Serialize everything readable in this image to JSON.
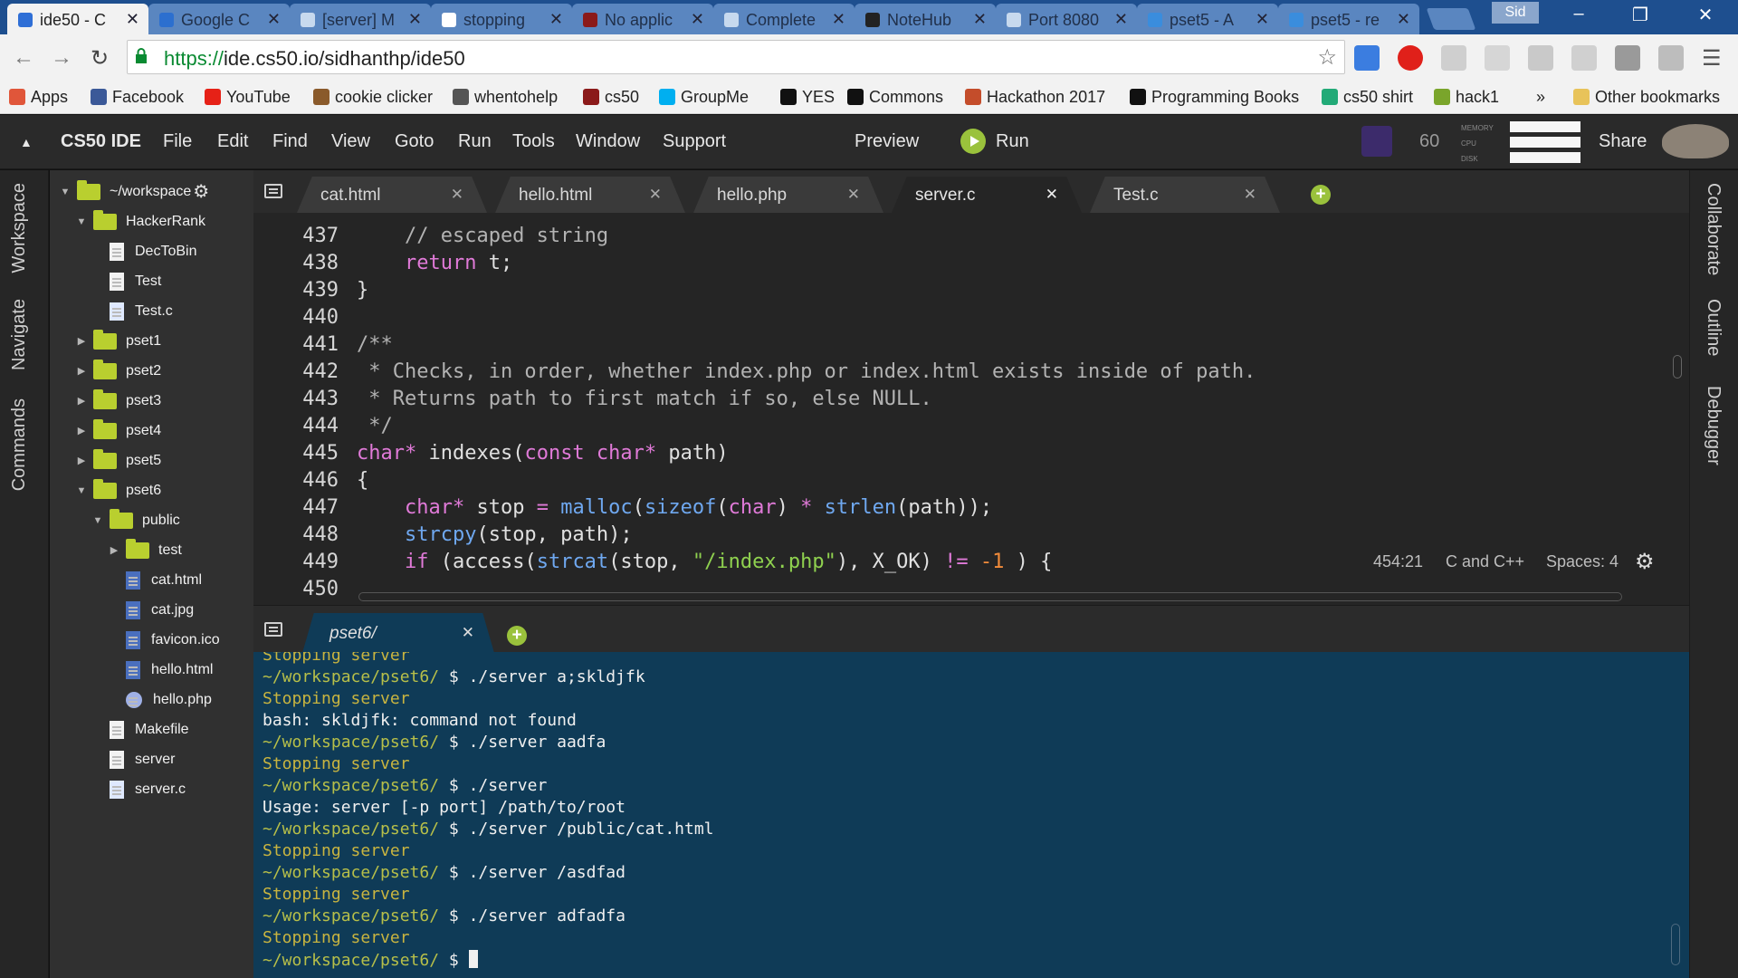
{
  "browser": {
    "tabs": [
      {
        "title": "ide50 - C",
        "color": "#2f6fd6",
        "active": true
      },
      {
        "title": "Google C",
        "color": "#2c6fcf"
      },
      {
        "title": "[server] M",
        "color": "#c7d9ee"
      },
      {
        "title": "stopping",
        "color": "#ffffff"
      },
      {
        "title": "No applic",
        "color": "#8b1a1a"
      },
      {
        "title": "Complete",
        "color": "#c7d9ee"
      },
      {
        "title": "NoteHub",
        "color": "#222222"
      },
      {
        "title": "Port 8080",
        "color": "#c7d9ee"
      },
      {
        "title": "pset5 - A",
        "color": "#3a8ddd"
      },
      {
        "title": "pset5 - re",
        "color": "#3a8ddd"
      }
    ],
    "tab_close": "✕",
    "user_chip": "Sid",
    "window_controls": {
      "minimize": "–",
      "maximize": "❐",
      "close": "✕"
    },
    "url_scheme": "https://",
    "url_rest": "ide.cs50.io/sidhanthp/ide50",
    "bookmarks": [
      {
        "label": "Apps",
        "icon": "apps-grid-icon",
        "color": "#e0563a"
      },
      {
        "label": "Facebook",
        "icon": "facebook-icon",
        "color": "#3b5998"
      },
      {
        "label": "YouTube",
        "icon": "youtube-icon",
        "color": "#e62117"
      },
      {
        "label": "cookie clicker",
        "icon": "cookie-icon",
        "color": "#8a5a2b"
      },
      {
        "label": "whentohelp",
        "icon": "w-icon",
        "color": "#555555"
      },
      {
        "label": "cs50",
        "icon": "harvard-shield-icon",
        "color": "#8b1a1a"
      },
      {
        "label": "GroupMe",
        "icon": "groupme-icon",
        "color": "#00aff0"
      },
      {
        "label": "YES",
        "icon": "v-icon",
        "color": "#111111"
      },
      {
        "label": "Commons",
        "icon": "commons-icon",
        "color": "#111111"
      },
      {
        "label": "Hackathon 2017",
        "icon": "hackathon-icon",
        "color": "#c44d2b"
      },
      {
        "label": "Programming Books",
        "icon": "github-icon",
        "color": "#111111"
      },
      {
        "label": "cs50 shirt",
        "icon": "shirt-icon",
        "color": "#22aa77"
      },
      {
        "label": "hack1",
        "icon": "h-icon",
        "color": "#7aa52b"
      }
    ],
    "bookmarks_overflow": "»",
    "other_bookmarks": "Other bookmarks"
  },
  "ide": {
    "brand": "CS50 IDE",
    "menu": [
      "File",
      "Edit",
      "Find",
      "View",
      "Goto",
      "Run",
      "Tools",
      "Window",
      "Support"
    ],
    "preview": "Preview",
    "run": "Run",
    "count": "60",
    "meter_labels": [
      "MEMORY",
      "CPU",
      "DISK"
    ],
    "share": "Share",
    "left_tabs": [
      "Workspace",
      "Navigate",
      "Commands"
    ],
    "right_tabs": [
      "Collaborate",
      "Outline",
      "Debugger"
    ],
    "tree": [
      {
        "label": "~/workspace",
        "type": "folder",
        "depth": 0,
        "open": true
      },
      {
        "label": "HackerRank",
        "type": "folder",
        "depth": 1,
        "open": true
      },
      {
        "label": "DecToBin",
        "type": "file",
        "depth": 2
      },
      {
        "label": "Test",
        "type": "file",
        "depth": 2
      },
      {
        "label": "Test.c",
        "type": "c",
        "depth": 2
      },
      {
        "label": "pset1",
        "type": "folder",
        "depth": 1,
        "open": false
      },
      {
        "label": "pset2",
        "type": "folder",
        "depth": 1,
        "open": false
      },
      {
        "label": "pset3",
        "type": "folder",
        "depth": 1,
        "open": false
      },
      {
        "label": "pset4",
        "type": "folder",
        "depth": 1,
        "open": false
      },
      {
        "label": "pset5",
        "type": "folder",
        "depth": 1,
        "open": false
      },
      {
        "label": "pset6",
        "type": "folder",
        "depth": 1,
        "open": true
      },
      {
        "label": "public",
        "type": "folder",
        "depth": 2,
        "open": true
      },
      {
        "label": "test",
        "type": "folder",
        "depth": 3,
        "open": false
      },
      {
        "label": "cat.html",
        "type": "img",
        "depth": 3
      },
      {
        "label": "cat.jpg",
        "type": "img",
        "depth": 3
      },
      {
        "label": "favicon.ico",
        "type": "img",
        "depth": 3
      },
      {
        "label": "hello.html",
        "type": "img",
        "depth": 3
      },
      {
        "label": "hello.php",
        "type": "php",
        "depth": 3
      },
      {
        "label": "Makefile",
        "type": "file",
        "depth": 2
      },
      {
        "label": "server",
        "type": "file",
        "depth": 2
      },
      {
        "label": "server.c",
        "type": "c",
        "depth": 2
      }
    ],
    "editor_tabs": [
      {
        "label": "cat.html",
        "active": false
      },
      {
        "label": "hello.html",
        "active": false
      },
      {
        "label": "hello.php",
        "active": false
      },
      {
        "label": "server.c",
        "active": true
      },
      {
        "label": "Test.c",
        "active": false
      }
    ],
    "code": [
      {
        "n": "437",
        "parts": [
          [
            "cm",
            "    // escaped string"
          ]
        ]
      },
      {
        "n": "438",
        "parts": [
          [
            "kw",
            "    return"
          ],
          [
            "",
            " t;"
          ]
        ]
      },
      {
        "n": "439",
        "parts": [
          [
            "",
            "}"
          ]
        ]
      },
      {
        "n": "440",
        "parts": []
      },
      {
        "n": "441",
        "parts": [
          [
            "cm",
            "/**"
          ]
        ]
      },
      {
        "n": "442",
        "parts": [
          [
            "cm",
            " * Checks, in order, whether index.php or index.html exists inside of path."
          ]
        ]
      },
      {
        "n": "443",
        "parts": [
          [
            "cm",
            " * Returns path to first match if so, else NULL."
          ]
        ]
      },
      {
        "n": "444",
        "parts": [
          [
            "cm",
            " */"
          ]
        ]
      },
      {
        "n": "445",
        "parts": [
          [
            "kw",
            "char"
          ],
          [
            "op",
            "*"
          ],
          [
            "",
            " indexes("
          ],
          [
            "kw",
            "const char"
          ],
          [
            "op",
            "*"
          ],
          [
            "",
            " path)"
          ]
        ]
      },
      {
        "n": "446",
        "parts": [
          [
            "",
            "{"
          ]
        ]
      },
      {
        "n": "447",
        "parts": [
          [
            "kw",
            "    char"
          ],
          [
            "op",
            "*"
          ],
          [
            "",
            " stop "
          ],
          [
            "op",
            "="
          ],
          [
            "",
            " "
          ],
          [
            "fn",
            "malloc"
          ],
          [
            "",
            "("
          ],
          [
            "fn",
            "sizeof"
          ],
          [
            "",
            "("
          ],
          [
            "kw",
            "char"
          ],
          [
            "",
            ") "
          ],
          [
            "op",
            "*"
          ],
          [
            "",
            " "
          ],
          [
            "fn",
            "strlen"
          ],
          [
            "",
            "(path));"
          ]
        ]
      },
      {
        "n": "448",
        "parts": [
          [
            "fn",
            "    strcpy"
          ],
          [
            "",
            "(stop, path);"
          ]
        ]
      },
      {
        "n": "449",
        "parts": [
          [
            "kw",
            "    if"
          ],
          [
            "",
            " (access("
          ],
          [
            "fn",
            "strcat"
          ],
          [
            "",
            "(stop, "
          ],
          [
            "str",
            "\"/index.php\""
          ],
          [
            "",
            "), X_OK) "
          ],
          [
            "op",
            "!="
          ],
          [
            "",
            " "
          ],
          [
            "num",
            "-1"
          ],
          [
            "",
            " ) {"
          ]
        ]
      },
      {
        "n": "450",
        "parts": []
      }
    ],
    "status": {
      "cursor": "454:21",
      "language": "C and C++",
      "spaces": "Spaces: 4"
    },
    "terminal_tab": "pset6/",
    "terminal": [
      {
        "ps": "",
        "cmd": "",
        "out": "Stopping server",
        "y": true
      },
      {
        "ps": "~/workspace/pset6/",
        "cmd": " $ ./server a;skldjfk"
      },
      {
        "ps": "",
        "cmd": "",
        "out": "Stopping server",
        "y": true
      },
      {
        "ps": "",
        "cmd": "",
        "out": "bash: skldjfk: command not found"
      },
      {
        "ps": "~/workspace/pset6/",
        "cmd": " $ ./server aadfa"
      },
      {
        "ps": "",
        "cmd": "",
        "out": "Stopping server",
        "y": true
      },
      {
        "ps": "~/workspace/pset6/",
        "cmd": " $ ./server"
      },
      {
        "ps": "",
        "cmd": "",
        "out": "Usage: server [-p port] /path/to/root"
      },
      {
        "ps": "~/workspace/pset6/",
        "cmd": " $ ./server /public/cat.html"
      },
      {
        "ps": "",
        "cmd": "",
        "out": "Stopping server",
        "y": true
      },
      {
        "ps": "~/workspace/pset6/",
        "cmd": " $ ./server /asdfad"
      },
      {
        "ps": "",
        "cmd": "",
        "out": "Stopping server",
        "y": true
      },
      {
        "ps": "~/workspace/pset6/",
        "cmd": " $ ./server adfadfa"
      },
      {
        "ps": "",
        "cmd": "",
        "out": "Stopping server",
        "y": true
      },
      {
        "ps": "~/workspace/pset6/",
        "cmd": " $ ",
        "cursor": true
      }
    ]
  }
}
